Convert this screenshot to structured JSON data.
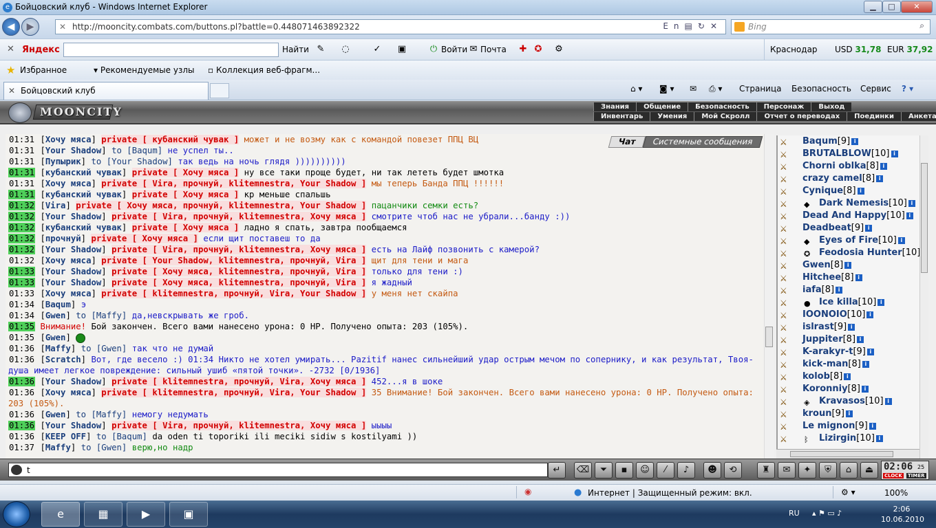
{
  "window": {
    "title": "Бойцовский клуб - Windows Internet Explorer",
    "min_glyph": "▁",
    "max_glyph": "□",
    "close_glyph": "✕"
  },
  "addressbar": {
    "url": "http://mooncity.combats.com/buttons.pl?battle=0.448071463892322",
    "lang": "En",
    "search_placeholder": "Bing"
  },
  "yandex": {
    "logo": "Яндекс",
    "find": "Найти",
    "login": "Войти",
    "mail": "Почта",
    "city": "Краснодар",
    "usd_label": "USD",
    "usd": "31,78",
    "eur_label": "EUR",
    "eur": "37,92"
  },
  "favorites": {
    "label": "Избранное",
    "suggested": "Рекомендуемые узлы",
    "webslices": "Коллекция веб-фрагм..."
  },
  "tab": {
    "title": "Бойцовский клуб"
  },
  "commands": [
    "Страница",
    "Безопасность",
    "Сервис"
  ],
  "game": {
    "logo": "MOONCITY",
    "menu_top": [
      "Знания",
      "Общение",
      "Безопасность",
      "Персонаж",
      "Выход"
    ],
    "menu_bottom": [
      "Инвентарь",
      "Умения",
      "Мой Скролл",
      "Отчет о переводах",
      "Поединки",
      "Анкета"
    ],
    "chat_tabs": [
      "Чат",
      "Системные сообщения"
    ]
  },
  "chat": [
    {
      "t": "01:31",
      "hl": false,
      "nick": "Хочу мяса",
      "priv": "private [ кубанский чувак ]",
      "text": "может и не возму как с командой повезет ППЦ ВЦ",
      "color": "brown"
    },
    {
      "t": "01:31",
      "hl": false,
      "nick": "Your Shadow",
      "to": "to [Baqum]",
      "text": "не успел ты..",
      "color": "blue"
    },
    {
      "t": "01:31",
      "hl": false,
      "nick": "Пупырик",
      "to": "to [Your Shadow]",
      "text": "так ведь на ночь глядя ))))))))))",
      "color": "blue"
    },
    {
      "t": "01:31",
      "hl": true,
      "nick": "кубанский чувак",
      "priv": "private [ Хочу мяса ]",
      "text": "ну все таки проще будет, ни так лететь будет шмотка",
      "color": "black"
    },
    {
      "t": "01:31",
      "hl": false,
      "nick": "Хочу мяса",
      "priv": "private [ Vira, прочнуй, klitemnestra, Your Shadow ]",
      "text": "мы теперь Банда ППЦ !!!!!!",
      "color": "brown"
    },
    {
      "t": "01:31",
      "hl": true,
      "nick": "кубанский чувак",
      "priv": "private [ Хочу мяса ]",
      "text": "кр меньше спальшь",
      "color": "black"
    },
    {
      "t": "01:32",
      "hl": true,
      "nick": "Vira",
      "priv": "private [ Хочу мяса, прочнуй, klitemnestra, Your Shadow ]",
      "text": "пацанчики семки есть?",
      "color": "green"
    },
    {
      "t": "01:32",
      "hl": true,
      "nick": "Your Shadow",
      "priv": "private [ Vira, прочнуй, klitemnestra, Хочу мяса ]",
      "text": "смотрите чтоб нас не убрали...банду :))",
      "color": "blue"
    },
    {
      "t": "01:32",
      "hl": true,
      "nick": "кубанский чувак",
      "priv": "private [ Хочу мяса ]",
      "text": "ладно я спать, завтра пообщаемся",
      "color": "black"
    },
    {
      "t": "01:32",
      "hl": true,
      "nick": "прочнуй",
      "priv": "private [ Хочу мяса ]",
      "text": "если щит поставеш то да",
      "color": "blue"
    },
    {
      "t": "01:32",
      "hl": true,
      "nick": "Your Shadow",
      "priv": "private [ Vira, прочнуй, klitemnestra, Хочу мяса ]",
      "text": "есть на Лайф позвонить с камерой?",
      "color": "blue"
    },
    {
      "t": "01:32",
      "hl": false,
      "nick": "Хочу мяса",
      "priv": "private [ Your Shadow, klitemnestra, прочнуй, Vira ]",
      "text": "щит для тени и мага",
      "color": "brown"
    },
    {
      "t": "01:33",
      "hl": true,
      "nick": "Your Shadow",
      "priv": "private [ Хочу мяса, klitemnestra, прочнуй, Vira ]",
      "text": "только для тени :)",
      "color": "blue"
    },
    {
      "t": "01:33",
      "hl": true,
      "nick": "Your Shadow",
      "priv": "private [ Хочу мяса, klitemnestra, прочнуй, Vira ]",
      "text": "я жадный",
      "color": "blue"
    },
    {
      "t": "01:33",
      "hl": false,
      "nick": "Хочу мяса",
      "priv": "private [ klitemnestra, прочнуй, Vira, Your Shadow ]",
      "text": "у меня нет скайпа",
      "color": "brown"
    },
    {
      "t": "01:34",
      "hl": false,
      "nick": "Baqum",
      "text": "э",
      "color": "blue"
    },
    {
      "t": "01:34",
      "hl": false,
      "nick": "Gwen",
      "to": "to [Maffy]",
      "text": "да,невскрывать же гроб.",
      "color": "blue"
    },
    {
      "t": "01:35",
      "hl": true,
      "system": true,
      "alert": "Внимание!",
      "text": "Бой закончен. Всего вами нанесено урона: 0 HP. Получено опыта: 203 (105%)."
    },
    {
      "t": "01:35",
      "hl": false,
      "nick": "Gwen",
      "smiley": true,
      "text": "",
      "color": "blue"
    },
    {
      "t": "01:36",
      "hl": false,
      "nick": "Maffy",
      "to": "to [Gwen]",
      "text": "так что не думай",
      "color": "blue"
    },
    {
      "t": "01:36",
      "hl": false,
      "wrap": true,
      "nick": "Scratch",
      "text": "Вот, где весело :) 01:34 Никто не хотел умирать... Pazitif нанес сильнейший удар острым мечом по сопернику, и как результат, Твоя-душа имеет легкое повреждение: сильный ушиб «пятой точки». -2732 [0/1936]",
      "color": "blue"
    },
    {
      "t": "01:36",
      "hl": true,
      "nick": "Your Shadow",
      "priv": "private [ klitemnestra, прочнуй, Vira, Хочу мяса ]",
      "text": "452...я в шоке",
      "color": "blue"
    },
    {
      "t": "01:36",
      "hl": false,
      "wrap": true,
      "nick": "Хочу мяса",
      "priv": "private [ klitemnestra, прочнуй, Vira, Your Shadow ]",
      "text": "35 Внимание! Бой закончен. Всего вами нанесено урона: 0 HP. Получено опыта: 203 (105%).",
      "color": "brown"
    },
    {
      "t": "01:36",
      "hl": false,
      "nick": "Gwen",
      "to": "to [Maffy]",
      "text": "немогу недумать",
      "color": "blue"
    },
    {
      "t": "01:36",
      "hl": true,
      "nick": "Your Shadow",
      "priv": "private [ Vira, прочнуй, klitemnestra, Хочу мяса ]",
      "text": "ыыыы",
      "color": "blue"
    },
    {
      "t": "01:36",
      "hl": false,
      "nick": "KEEP OFF",
      "to": "to [Baqum]",
      "text": "da oden ti toporiki ili meciki sidiw s kostilyami ))",
      "color": "black"
    },
    {
      "t": "01:37",
      "hl": false,
      "nick": "Maffy",
      "to": "to [Gwen]",
      "text": "верю,но надр",
      "color": "green"
    }
  ],
  "users": [
    {
      "name": "Baqum",
      "lvl": "[9]",
      "clan": ""
    },
    {
      "name": "BRUTALBLOW",
      "lvl": "[10]",
      "clan": ""
    },
    {
      "name": "Chorni oblka",
      "lvl": "[8]",
      "clan": ""
    },
    {
      "name": "crazy camel",
      "lvl": "[8]",
      "clan": ""
    },
    {
      "name": "Cynique",
      "lvl": "[8]",
      "clan": ""
    },
    {
      "name": "Dark Nemesis",
      "lvl": "[10]",
      "clan": "◆"
    },
    {
      "name": "Dead And Happy",
      "lvl": "[10]",
      "clan": ""
    },
    {
      "name": "Deadbeat",
      "lvl": "[9]",
      "clan": ""
    },
    {
      "name": "Eyes of Fire",
      "lvl": "[10]",
      "clan": "◆"
    },
    {
      "name": "Feodosia Hunter",
      "lvl": "[10]",
      "clan": "✪"
    },
    {
      "name": "Gwen",
      "lvl": "[8]",
      "clan": ""
    },
    {
      "name": "Hitchee",
      "lvl": "[8]",
      "clan": ""
    },
    {
      "name": "iafa",
      "lvl": "[8]",
      "clan": ""
    },
    {
      "name": "Ice killa",
      "lvl": "[10]",
      "clan": "●"
    },
    {
      "name": "IOONOIO",
      "lvl": "[10]",
      "clan": ""
    },
    {
      "name": "islrast",
      "lvl": "[9]",
      "clan": ""
    },
    {
      "name": "Juppiter",
      "lvl": "[8]",
      "clan": ""
    },
    {
      "name": "K-arakyr-t",
      "lvl": "[9]",
      "clan": ""
    },
    {
      "name": "kick-man",
      "lvl": "[8]",
      "clan": ""
    },
    {
      "name": "kolob",
      "lvl": "[8]",
      "clan": ""
    },
    {
      "name": "Koronniy",
      "lvl": "[8]",
      "clan": ""
    },
    {
      "name": "Kravasos",
      "lvl": "[10]",
      "clan": "◈"
    },
    {
      "name": "kroun",
      "lvl": "[9]",
      "clan": ""
    },
    {
      "name": "Le mignon",
      "lvl": "[9]",
      "clan": ""
    },
    {
      "name": "Lizirgin",
      "lvl": "[10]",
      "clan": "ᛒ"
    }
  ],
  "input": {
    "value": "t"
  },
  "clock": {
    "time": "02:06",
    "sec": "25",
    "lbl1": "CLOCK",
    "lbl2": "TIMER"
  },
  "statusbar": {
    "zone": "Интернет | Защищенный режим: вкл.",
    "zoom": "100%"
  },
  "taskbar": {
    "lang": "RU",
    "time": "2:06",
    "date": "10.06.2010"
  },
  "colors": {
    "accent_green": "#4fd05a",
    "private_red": "#d20000",
    "nick_blue": "#1a3e7c"
  }
}
